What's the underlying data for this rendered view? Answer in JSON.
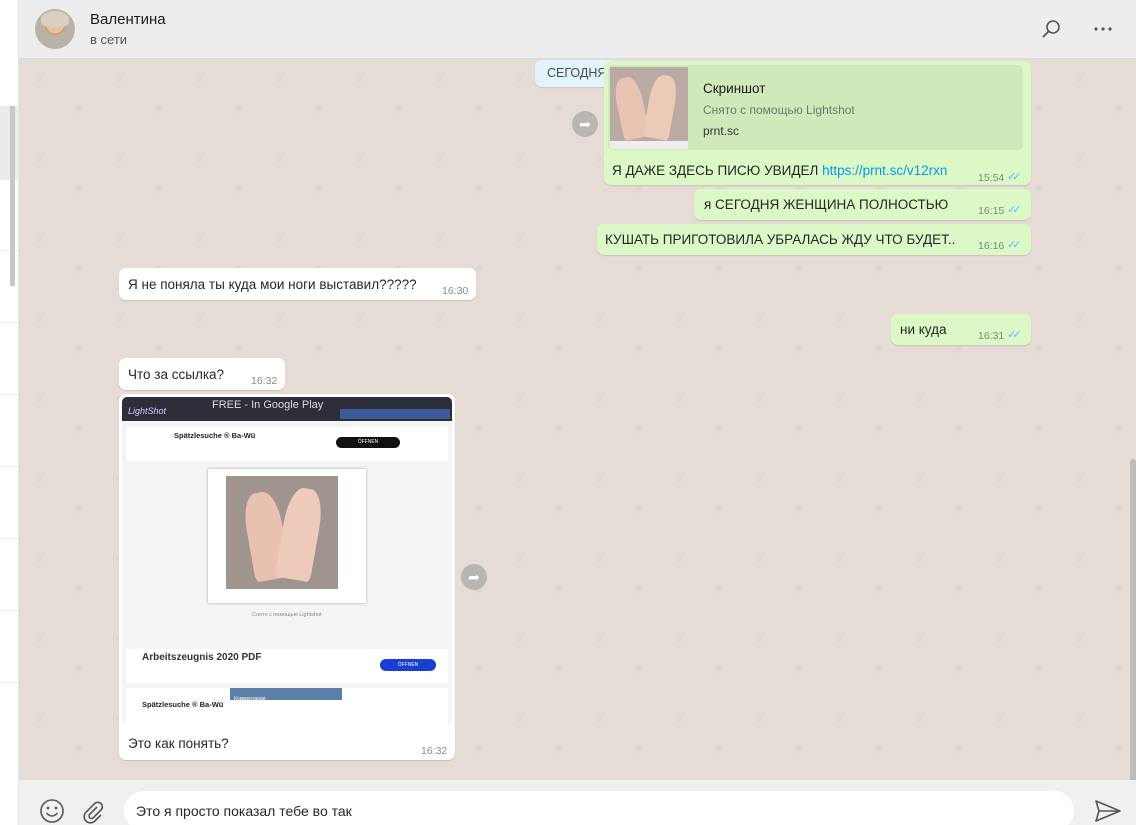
{
  "header": {
    "contact_name": "Валентина",
    "contact_status": "в сети",
    "icons": [
      "avatar",
      "search-icon",
      "menu-icon"
    ]
  },
  "chat": {
    "date_chip": "СЕГОДНЯ",
    "link_preview": {
      "title": "Скриншот",
      "description": "Снято с помощью Lightshot",
      "host": "prnt.sc"
    },
    "messages": [
      {
        "direction": "out",
        "text": "Я ДАЖЕ ЗДЕСЬ ПИСЮ УВИДЕЛ ",
        "link": "https://prnt.sc/v12rxn",
        "time": "15:54",
        "status": "read"
      },
      {
        "direction": "out",
        "text": "я СЕГОДНЯ ЖЕНЩИНА  ПОЛНОСТЬЮ",
        "time": "16:15",
        "status": "read"
      },
      {
        "direction": "out",
        "text": "КУШАТЬ ПРИГОТОВИЛА УБРАЛАСЬ ЖДУ ЧТО БУДЕТ..",
        "time": "16:16",
        "status": "read"
      },
      {
        "direction": "in",
        "text": "Я не поняла ты куда мои ноги выставил?????",
        "time": "16:30"
      },
      {
        "direction": "out",
        "text": "ни куда",
        "time": "16:31",
        "status": "read"
      },
      {
        "direction": "in",
        "text": "Что за ссылка?",
        "time": "16:32"
      },
      {
        "direction": "in",
        "text": "Это как понять?",
        "time": "16:32",
        "has_image": true
      }
    ],
    "screenshot_image": {
      "banner": "FREE - In Google Play",
      "logo": "LightShot",
      "ad1_title": "Spätzlesuche ® Ba-Wü",
      "ad1_button": "ÖFFNEN",
      "caption": "Снято с помощью Lightshot",
      "ad2_title": "Arbeitszeugnis 2020 PDF",
      "ad2_button": "ÖFFNEN",
      "bottom_title": "Spätzlesuche ® Ba-Wü",
      "bottom_panel": "Комментарии"
    },
    "ticks_glyph": "✓✓",
    "forward_glyph": "➦"
  },
  "footer": {
    "input_value": "Это я просто показал тебе во так",
    "icons": [
      "emoji-icon",
      "paperclip-icon",
      "send-icon"
    ]
  },
  "colors": {
    "outgoing_bubble": "#dcf8c6",
    "incoming_bubble": "#ffffff",
    "chat_background": "#e5ddd5",
    "read_ticks": "#4fc3f7",
    "link": "#039be5"
  }
}
